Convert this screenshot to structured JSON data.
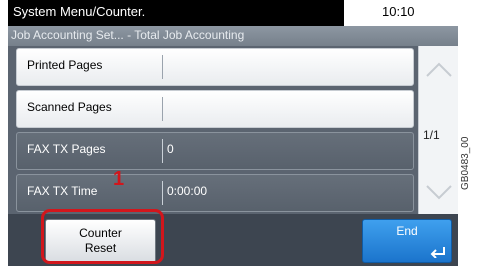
{
  "header": {
    "title": "System Menu/Counter.",
    "time": "10:10",
    "subtitle": "Job Accounting Set... - Total Job Accounting"
  },
  "rows": [
    {
      "label": "Printed Pages",
      "value": ""
    },
    {
      "label": "Scanned Pages",
      "value": ""
    },
    {
      "label": "FAX TX Pages",
      "value": "0"
    },
    {
      "label": "FAX TX Time",
      "value": "0:00:00"
    }
  ],
  "pager": {
    "page": "1/1"
  },
  "buttons": {
    "counter_line1": "Counter",
    "counter_line2": "Reset",
    "end": "End"
  },
  "annotation": {
    "step": "1"
  },
  "side_code": "GB0483_00",
  "colors": {
    "highlight": "#d2161c",
    "end_button": "#1b74cc"
  }
}
